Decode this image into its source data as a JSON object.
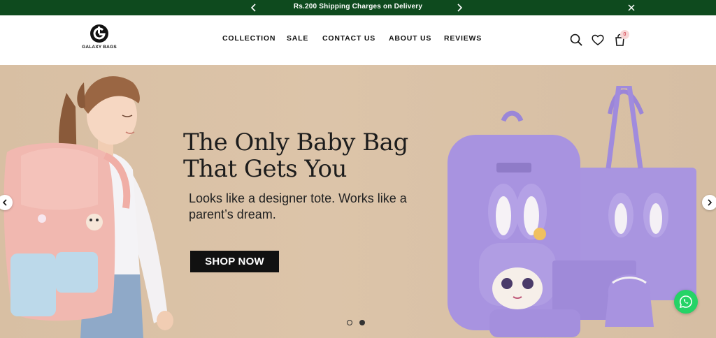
{
  "announcement": {
    "message": "Rs.200 Shipping Charges on Delivery",
    "prev_icon": "chevron-left-icon",
    "next_icon": "chevron-right-icon",
    "close_icon": "close-icon",
    "background": "#0e4a1e"
  },
  "header": {
    "logo_text": "GALAXY BAGS",
    "nav": [
      "COLLECTION",
      "SALE",
      "CONTACT US",
      "ABOUT US",
      "REVIEWS"
    ],
    "icons": [
      "search-icon",
      "heart-icon",
      "cart-icon"
    ],
    "cart_count": "0"
  },
  "hero": {
    "headline_line1": "The Only Baby Bag",
    "headline_line2": "That Gets You",
    "subline": "Looks like a designer tote. Works like a parent’s dream.",
    "cta": "SHOP NOW",
    "background": "#d9c1a6",
    "slides_total": 2,
    "active_slide": 2
  },
  "floating": {
    "whatsapp_icon": "whatsapp-icon",
    "color": "#25d366"
  }
}
